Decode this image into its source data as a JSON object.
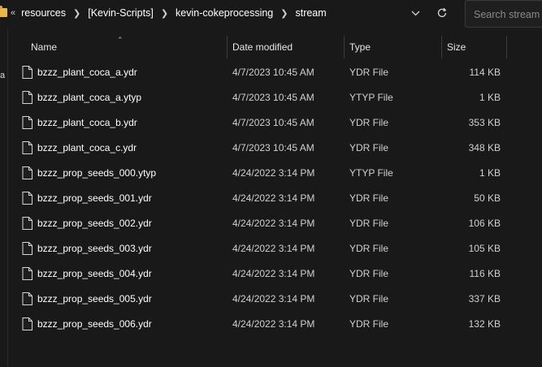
{
  "breadcrumb": {
    "overflow": "«",
    "items": [
      "resources",
      "[Kevin-Scripts]",
      "kevin-cokeprocessing",
      "stream"
    ]
  },
  "search": {
    "placeholder": "Search stream"
  },
  "columns": {
    "name": "Name",
    "date": "Date modified",
    "type": "Type",
    "size": "Size"
  },
  "files": [
    {
      "name": "bzzz_plant_coca_a.ydr",
      "date": "4/7/2023 10:45 AM",
      "type": "YDR File",
      "size": "114 KB"
    },
    {
      "name": "bzzz_plant_coca_a.ytyp",
      "date": "4/7/2023 10:45 AM",
      "type": "YTYP File",
      "size": "1 KB"
    },
    {
      "name": "bzzz_plant_coca_b.ydr",
      "date": "4/7/2023 10:45 AM",
      "type": "YDR File",
      "size": "353 KB"
    },
    {
      "name": "bzzz_plant_coca_c.ydr",
      "date": "4/7/2023 10:45 AM",
      "type": "YDR File",
      "size": "348 KB"
    },
    {
      "name": "bzzz_prop_seeds_000.ytyp",
      "date": "4/24/2022 3:14 PM",
      "type": "YTYP File",
      "size": "1 KB"
    },
    {
      "name": "bzzz_prop_seeds_001.ydr",
      "date": "4/24/2022 3:14 PM",
      "type": "YDR File",
      "size": "50 KB"
    },
    {
      "name": "bzzz_prop_seeds_002.ydr",
      "date": "4/24/2022 3:14 PM",
      "type": "YDR File",
      "size": "106 KB"
    },
    {
      "name": "bzzz_prop_seeds_003.ydr",
      "date": "4/24/2022 3:14 PM",
      "type": "YDR File",
      "size": "105 KB"
    },
    {
      "name": "bzzz_prop_seeds_004.ydr",
      "date": "4/24/2022 3:14 PM",
      "type": "YDR File",
      "size": "116 KB"
    },
    {
      "name": "bzzz_prop_seeds_005.ydr",
      "date": "4/24/2022 3:14 PM",
      "type": "YDR File",
      "size": "337 KB"
    },
    {
      "name": "bzzz_prop_seeds_006.ydr",
      "date": "4/24/2022 3:14 PM",
      "type": "YDR File",
      "size": "132 KB"
    }
  ],
  "nav_pane": {
    "partial_label": "a"
  },
  "colors": {
    "background": "#191919",
    "folder": "#e8b84a",
    "text": "#ffffff",
    "muted": "#d0d0d0"
  },
  "icons": [
    "folder-icon",
    "chevron-down-icon",
    "refresh-icon",
    "file-icon"
  ]
}
